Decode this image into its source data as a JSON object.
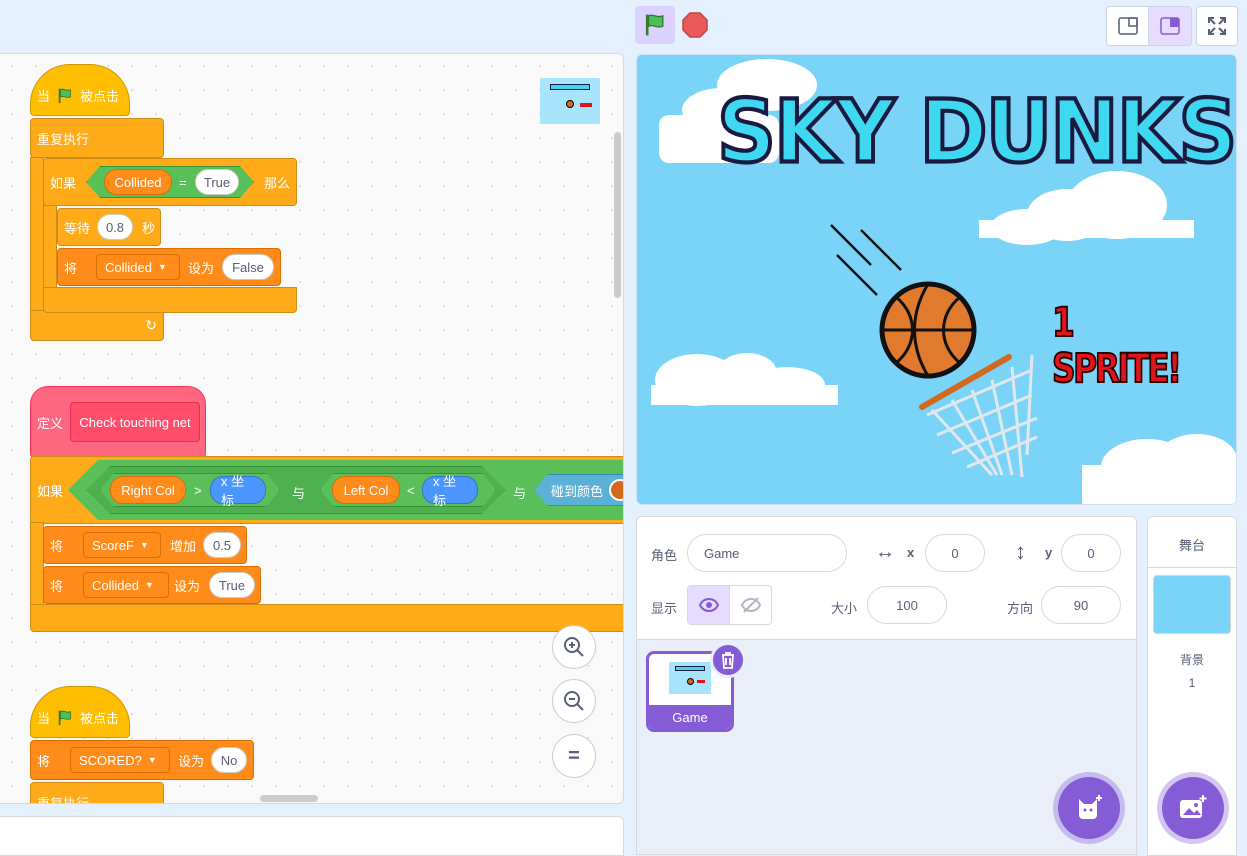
{
  "code": {
    "script1": {
      "hat_when": "当",
      "hat_clicked": "被点击",
      "forever": "重复执行",
      "if": "如果",
      "then": "那么",
      "cond_var": "Collided",
      "cond_op": "=",
      "cond_val": "True",
      "wait": "等待",
      "wait_val": "0.8",
      "wait_unit": "秒",
      "set": "将",
      "set_var": "Collided",
      "set_to": "设为",
      "set_val": "False"
    },
    "script2": {
      "define": "定义",
      "proc_name": "Check touching net",
      "if": "如果",
      "right_col": "Right Col",
      "gt": ">",
      "x_pos1": "x 坐标",
      "and1": "与",
      "left_col": "Left Col",
      "lt": "<",
      "x_pos2": "x 坐标",
      "and2": "与",
      "touch_color": "碰到颜色",
      "change": "将",
      "change_var": "ScoreF",
      "change_by": "增加",
      "change_val": "0.5",
      "set": "将",
      "set_var": "Collided",
      "set_to": "设为",
      "set_val": "True"
    },
    "script3": {
      "hat_when": "当",
      "hat_clicked": "被点击",
      "set": "将",
      "set_var": "SCORED?",
      "set_to": "设为",
      "set_val": "No",
      "forever": "重复执行"
    },
    "zoom": {
      "in": "+",
      "out": "−",
      "reset": "="
    }
  },
  "stage": {
    "title": "SKY DUNKS",
    "subtitle": "1 SPRITE!"
  },
  "sprite_info": {
    "sprite_label": "角色",
    "sprite_name": "Game",
    "x_label": "x",
    "x_value": "0",
    "y_label": "y",
    "y_value": "0",
    "show_label": "显示",
    "size_label": "大小",
    "size_value": "100",
    "direction_label": "方向",
    "direction_value": "90"
  },
  "sprites": [
    {
      "name": "Game"
    }
  ],
  "stage_panel": {
    "title": "舞台",
    "backdrop_label": "背景",
    "backdrop_count": "1"
  },
  "colors": {
    "accent": "#855cd6",
    "control": "#ffab19",
    "variables": "#ff8c1a",
    "events": "#ffbf00",
    "operators": "#59c059",
    "my_blocks": "#ff6680",
    "motion": "#4c97ff",
    "stage_sky": "#7ad4f8"
  }
}
